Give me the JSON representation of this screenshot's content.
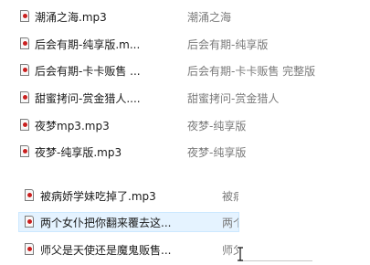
{
  "files": [
    {
      "name": "潮涌之海.mp3",
      "title": "潮涌之海",
      "icon": "audio-file-icon"
    },
    {
      "name": "后会有期-纯享版.m...",
      "title": "后会有期-纯享版",
      "icon": "audio-file-icon"
    },
    {
      "name": "后会有期-卡卡贩售 ...",
      "title": "后会有期-卡卡贩售 完整版",
      "icon": "audio-file-icon"
    },
    {
      "name": "甜蜜拷问-赏金猎人....",
      "title": "甜蜜拷问-赏金猎人",
      "icon": "audio-file-icon"
    },
    {
      "name": "夜梦mp3.mp3",
      "title": "夜梦-纯享版",
      "icon": "audio-file-icon"
    },
    {
      "name": "夜梦-纯享版.mp3",
      "title": "夜梦-纯享版",
      "icon": "audio-file-icon"
    }
  ],
  "files_b": [
    {
      "name": "被病娇学妹吃掉了.mp3",
      "title": "被病",
      "icon": "audio-file-icon"
    },
    {
      "name": "两个女仆把你翻来覆去这...",
      "title": "两个",
      "icon": "audio-file-icon",
      "selected": true
    },
    {
      "name": "师父是天使还是魔鬼贩售...",
      "title": "师父",
      "icon": "audio-file-icon"
    }
  ],
  "colors": {
    "selection": "#e5f3ff",
    "selection_border": "#cce8ff",
    "title_text": "#7a7a7a",
    "icon_accent": "#c9201f"
  }
}
